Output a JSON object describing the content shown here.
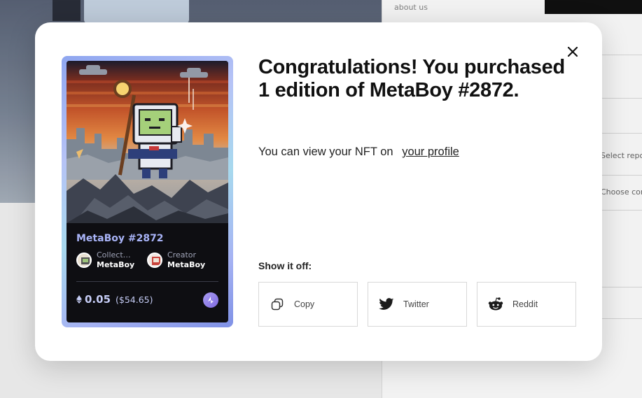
{
  "background": {
    "top_small_text": "about us",
    "right_fragment_1": "Select repo",
    "right_fragment_2": "Choose conte"
  },
  "modal": {
    "headline": "Congratulations! You purchased 1 edition of MetaBoy #2872.",
    "subtext_prefix": "You can view your NFT on",
    "profile_link": "your profile",
    "show_off_label": "Show it off:",
    "close_icon": "close-icon"
  },
  "nft_card": {
    "name": "MetaBoy #2872",
    "collection_label": "Collection",
    "collection_value": "MetaBoy",
    "creator_label": "Creator",
    "creator_value": "MetaBoy",
    "price_eth": "0.05",
    "price_usd": "($54.65)",
    "currency_icon": "ethereum-icon",
    "chain_icon": "loopring-icon",
    "frame_colors": [
      "#8fa6f0",
      "#a7d9ee",
      "#7f91e6"
    ]
  },
  "share_buttons": [
    {
      "label": "Copy",
      "icon": "copy-icon"
    },
    {
      "label": "Twitter",
      "icon": "twitter-icon"
    },
    {
      "label": "Reddit",
      "icon": "reddit-icon"
    }
  ]
}
